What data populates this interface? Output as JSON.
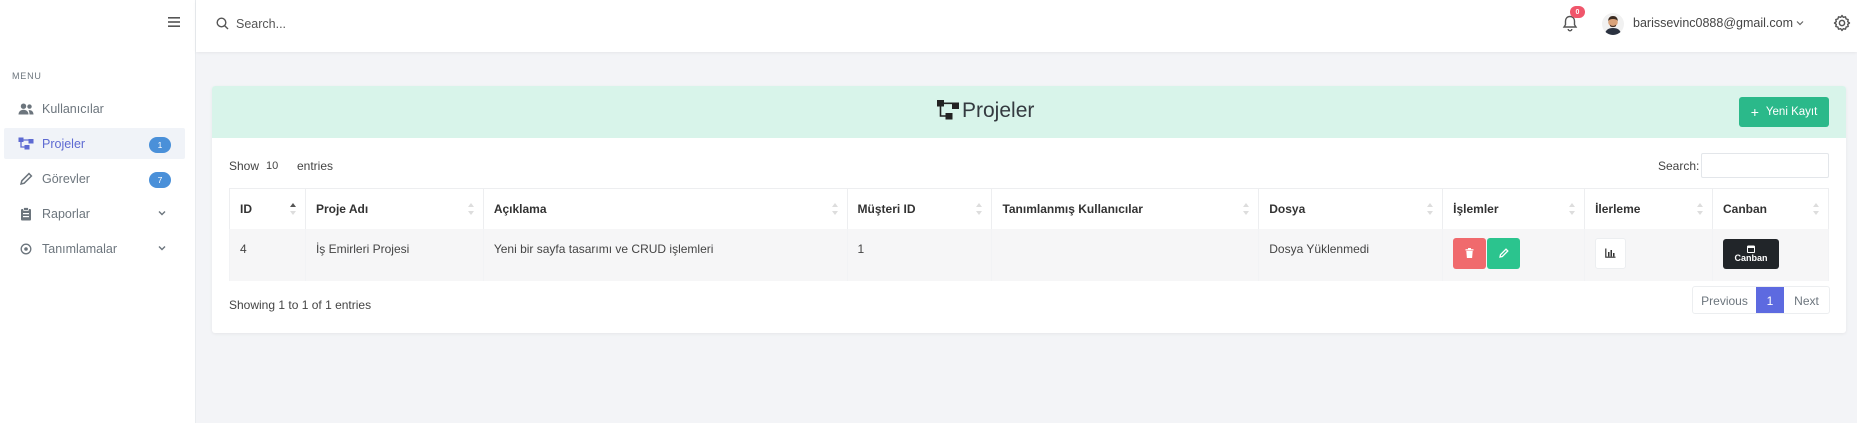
{
  "sidebar": {
    "menu_title": "MENU",
    "items": [
      {
        "label": "Kullanıcılar",
        "icon": "users-icon"
      },
      {
        "label": "Projeler",
        "icon": "sitemap-icon",
        "badge": "1",
        "active": true
      },
      {
        "label": "Görevler",
        "icon": "pencil-icon",
        "badge": "7"
      },
      {
        "label": "Raporlar",
        "icon": "clipboard-icon"
      },
      {
        "label": "Tanımlamalar",
        "icon": "location-icon"
      }
    ]
  },
  "topbar": {
    "search_placeholder": "Search...",
    "notification_count": "0",
    "user_email": "barissevinc0888@gmail.com"
  },
  "page": {
    "title": "Projeler",
    "new_button": "Yeni Kayıt"
  },
  "table": {
    "show_label": "Show",
    "page_size": "10",
    "entries_label": "entries",
    "search_label": "Search:",
    "columns": [
      "ID",
      "Proje Adı",
      "Açıklama",
      "Müşteri ID",
      "Tanımlanmış Kullanıcılar",
      "Dosya",
      "İşlemler",
      "İlerleme",
      "Canban"
    ],
    "rows": [
      {
        "id": "4",
        "name": "İş Emirleri Projesi",
        "description": "Yeni bir sayfa tasarımı ve CRUD işlemleri",
        "customer_id": "1",
        "assigned_users": "",
        "file": "Dosya Yüklenmedi",
        "canban_label": "Canban"
      }
    ],
    "info": "Showing 1 to 1 of 1 entries",
    "pagination": {
      "previous": "Previous",
      "current": "1",
      "next": "Next"
    }
  },
  "colors": {
    "accent": "#5d6ae0",
    "header_bg": "#d8f4ea",
    "success": "#2bb98a",
    "danger": "#f06a6d",
    "dark": "#212529"
  }
}
